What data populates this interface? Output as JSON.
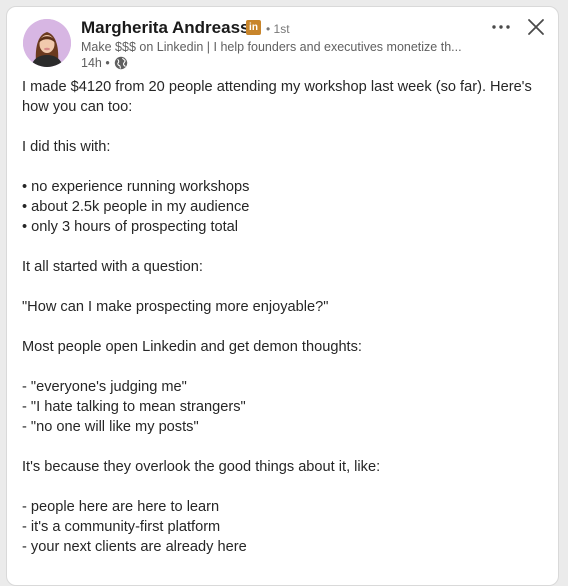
{
  "author": {
    "name": "Margherita Andreassi",
    "badge": "in",
    "degree": "• 1st",
    "headline": "Make $$$ on Linkedin | I help founders and executives monetize th...",
    "time": "14h •"
  },
  "icons": {
    "more": "more-horizontal-icon",
    "close": "close-icon",
    "visibility": "globe-icon"
  },
  "colors": {
    "badge": "#c8852b",
    "name": "#1a1a1a",
    "meta": "#606060",
    "body_text": "#262626"
  },
  "post": {
    "lines": [
      "I made $4120 from 20 people attending my workshop last week (so far). Here's",
      "how you can too:",
      "",
      "I did this with:",
      "",
      "• no experience running workshops",
      "• about 2.5k people in my audience",
      "• only 3 hours of prospecting total",
      "",
      "It all started with a question:",
      "",
      "\"How can I make prospecting more enjoyable?\"",
      "",
      "Most people open Linkedin and get demon thoughts:",
      "",
      "- \"everyone's judging me\"",
      "- \"I hate talking to mean strangers\"",
      "- \"no one will like my posts\"",
      "",
      "It's because they overlook the good things about it, like:",
      "",
      "- people here are here to learn",
      "- it's a community-first platform",
      "- your next clients are already here"
    ]
  }
}
